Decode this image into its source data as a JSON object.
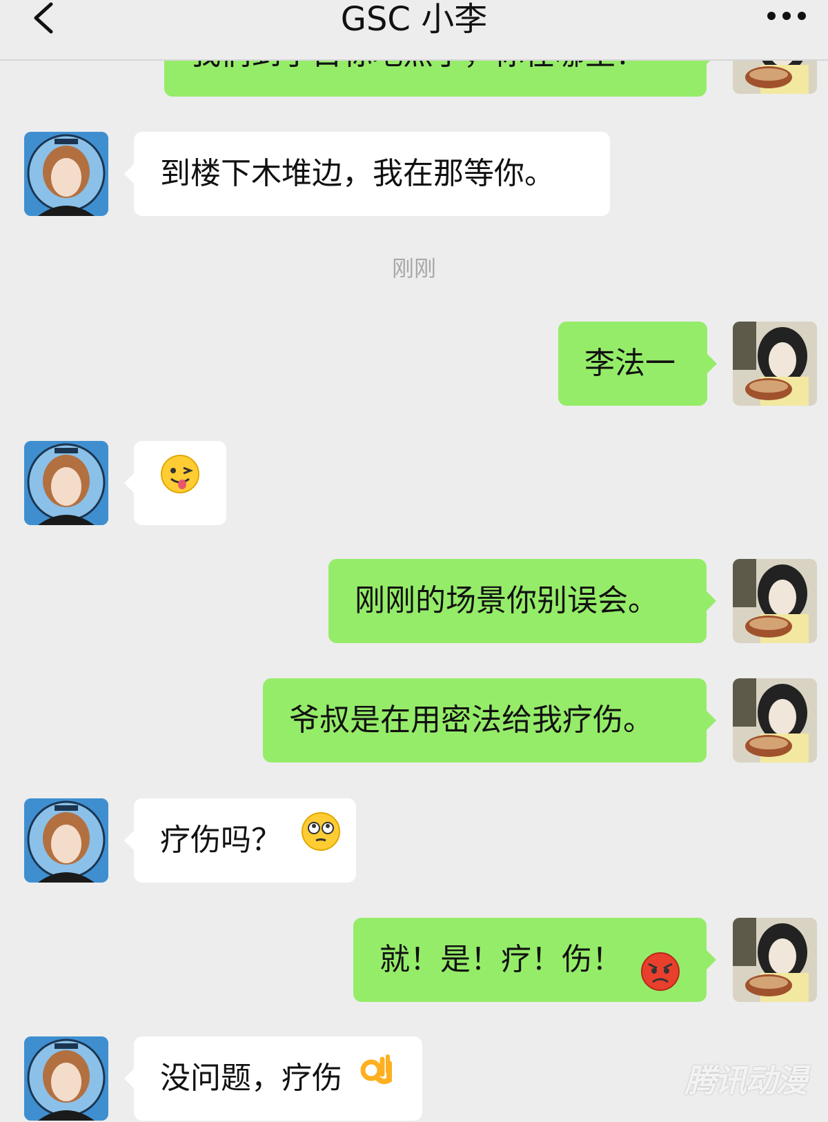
{
  "header": {
    "title": "GSC 小李",
    "back_icon": "chevron-left-icon",
    "more_icon": "more-dots-icon"
  },
  "messages": [
    {
      "side": "out",
      "text": "我们到了目标地点了，你在哪里？",
      "partial": true
    },
    {
      "side": "in",
      "text": "到楼下木堆边，我在那等你。"
    },
    {
      "side": "out",
      "text": "李法一"
    },
    {
      "side": "in",
      "text": "",
      "emoji": "winking-tongue-emoji"
    },
    {
      "side": "out",
      "text": "刚刚的场景你别误会。"
    },
    {
      "side": "out",
      "text": "爷叔是在用密法给我疗伤。"
    },
    {
      "side": "in",
      "text": "疗伤吗？",
      "emoji": "flushed-eyes-emoji"
    },
    {
      "side": "out",
      "text": "就！是！疗！伤！",
      "emoji": "angry-face-emoji"
    },
    {
      "side": "in",
      "text": "没问题，疗伤",
      "emoji": "ok-hand-emoji"
    }
  ],
  "timestamp": "刚刚",
  "watermark": "腾讯动漫",
  "colors": {
    "background": "#ededed",
    "outgoing_bubble": "#95ec69",
    "incoming_bubble": "#ffffff"
  }
}
